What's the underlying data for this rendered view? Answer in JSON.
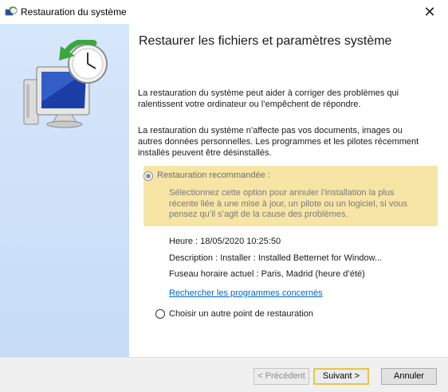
{
  "window": {
    "title": "Restauration du système",
    "close_glyph": "✕"
  },
  "main": {
    "heading": "Restaurer les fichiers et paramètres système",
    "paragraph1": "La restauration du système peut aider à corriger des problèmes qui ralentissent votre ordinateur ou l’empêchent de répondre.",
    "paragraph2": "La restauration du système n’affecte pas vos documents, images ou autres données personnelles. Les programmes et les pilotes récemment installés peuvent être désinstallés.",
    "recommended": {
      "label": "Restauration recommandée :",
      "description": "Sélectionnez cette option pour annuler l’installation la plus récente liée à une mise à jour, un pilote ou un logiciel, si vous pensez qu’il s’agit de la cause des problèmes.",
      "selected": true
    },
    "details": {
      "time": "Heure : 18/05/2020 10:25:50",
      "description": "Description : Installer : Installed Betternet for Window...",
      "timezone": "Fuseau horaire actuel : Paris, Madrid (heure d’été)"
    },
    "link": "Rechercher les programmes concernés",
    "alternate": {
      "label": "Choisir un autre point de restauration",
      "selected": false
    }
  },
  "footer": {
    "prev_label": "< Précédent",
    "next_label": "Suivant >",
    "cancel_label": "Annuler"
  },
  "colors": {
    "sidebar": "#d7e7fb",
    "highlight_box": "#f7e5a6",
    "link": "#0066cc",
    "focus_border": "#e5c64a"
  },
  "icons": {
    "title": "system-restore-icon",
    "illustration": "monitor-clock-restore-icon"
  }
}
